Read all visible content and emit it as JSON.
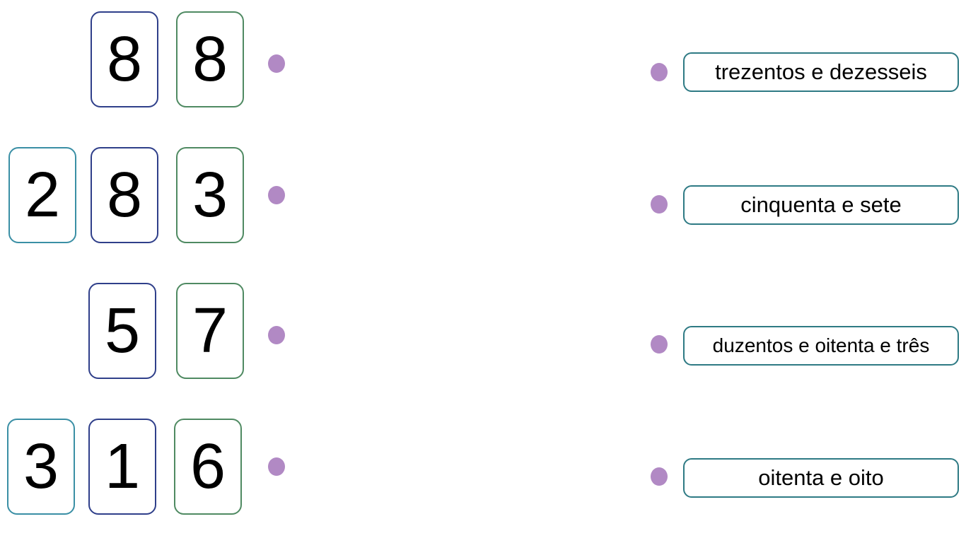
{
  "numbers": [
    {
      "digits": [
        "8",
        "8"
      ]
    },
    {
      "digits": [
        "2",
        "8",
        "3"
      ]
    },
    {
      "digits": [
        "5",
        "7"
      ]
    },
    {
      "digits": [
        "3",
        "1",
        "6"
      ]
    }
  ],
  "words": [
    "trezentos e dezesseis",
    "cinquenta e sete",
    "duzentos e oitenta e três",
    "oitenta e oito"
  ],
  "colors": {
    "hundreds_border": "#3a8fa5",
    "tens_border": "#2f3f8a",
    "units_border": "#4f8a62",
    "word_border": "#2e7a84",
    "dot": "#b189c4"
  }
}
